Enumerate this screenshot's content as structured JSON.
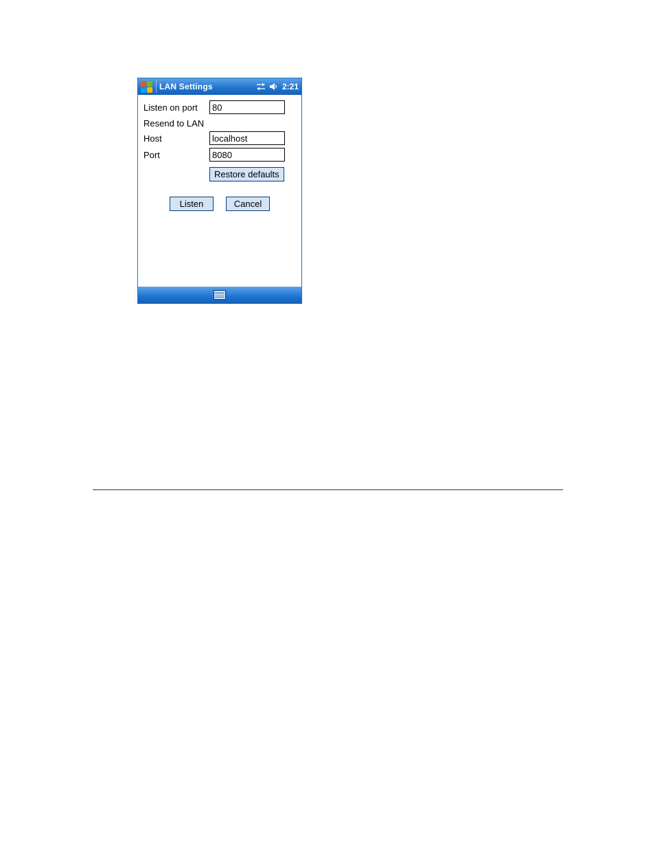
{
  "titlebar": {
    "title": "LAN Settings",
    "clock": "2:21"
  },
  "form": {
    "listen_on_port_label": "Listen on port",
    "listen_on_port_value": "80",
    "resend_label": "Resend to LAN",
    "host_label": "Host",
    "host_value": "localhost",
    "port_label": "Port",
    "port_value": "8080",
    "restore_defaults_label": "Restore defaults",
    "listen_button": "Listen",
    "cancel_button": "Cancel"
  }
}
